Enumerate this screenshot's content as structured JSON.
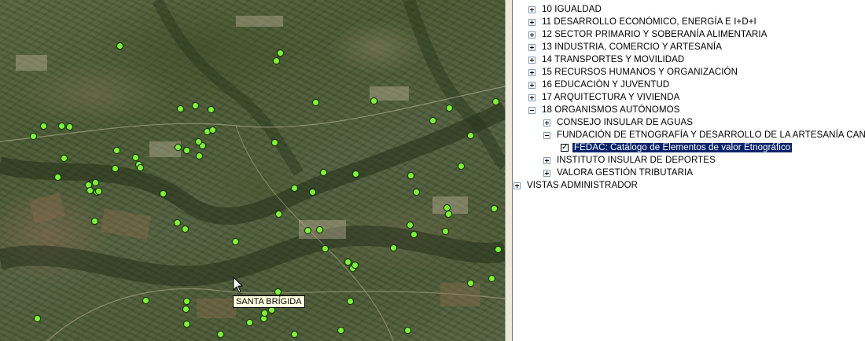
{
  "map": {
    "tooltip": "SANTA BRÍGIDA",
    "marker_color": "#7df23a"
  },
  "tree": {
    "items": [
      {
        "label": "10 IGUALDAD",
        "expander": "plus"
      },
      {
        "label": "11 DESARROLLO ECONÓMICO, ENERGÍA E I+D+I",
        "expander": "plus"
      },
      {
        "label": "12 SECTOR PRIMARIO Y SOBERANÍA ALIMENTARIA",
        "expander": "plus"
      },
      {
        "label": "13 INDUSTRIA, COMERCIO Y ARTESANÍA",
        "expander": "plus"
      },
      {
        "label": "14 TRANSPORTES Y MOVILIDAD",
        "expander": "plus"
      },
      {
        "label": "15 RECURSOS HUMANOS Y ORGANIZACIÓN",
        "expander": "plus"
      },
      {
        "label": "16 EDUCACIÓN Y JUVENTUD",
        "expander": "plus"
      },
      {
        "label": "17 ARQUITECTURA Y VIVIENDA",
        "expander": "plus"
      },
      {
        "label": "18 ORGANISMOS AUTÓNOMOS",
        "expander": "minus"
      },
      {
        "label": "CONSEJO INSULAR DE AGUAS",
        "expander": "plus"
      },
      {
        "label": "FUNDACIÓN DE ETNOGRAFÍA Y DESARROLLO DE LA ARTESANÍA CANARIA",
        "expander": "minus"
      },
      {
        "label": "FEDAC: Catálogo de Elementos de valor Etnográfico",
        "checked": true,
        "selected": true
      },
      {
        "label": "INSTITUTO INSULAR DE DEPORTES",
        "expander": "plus"
      },
      {
        "label": "VALORA GESTIÓN TRIBUTARIA",
        "expander": "plus"
      },
      {
        "label": "VISTAS ADMINISTRADOR",
        "expander": "plus"
      }
    ],
    "selection_color": "#0a246a"
  }
}
